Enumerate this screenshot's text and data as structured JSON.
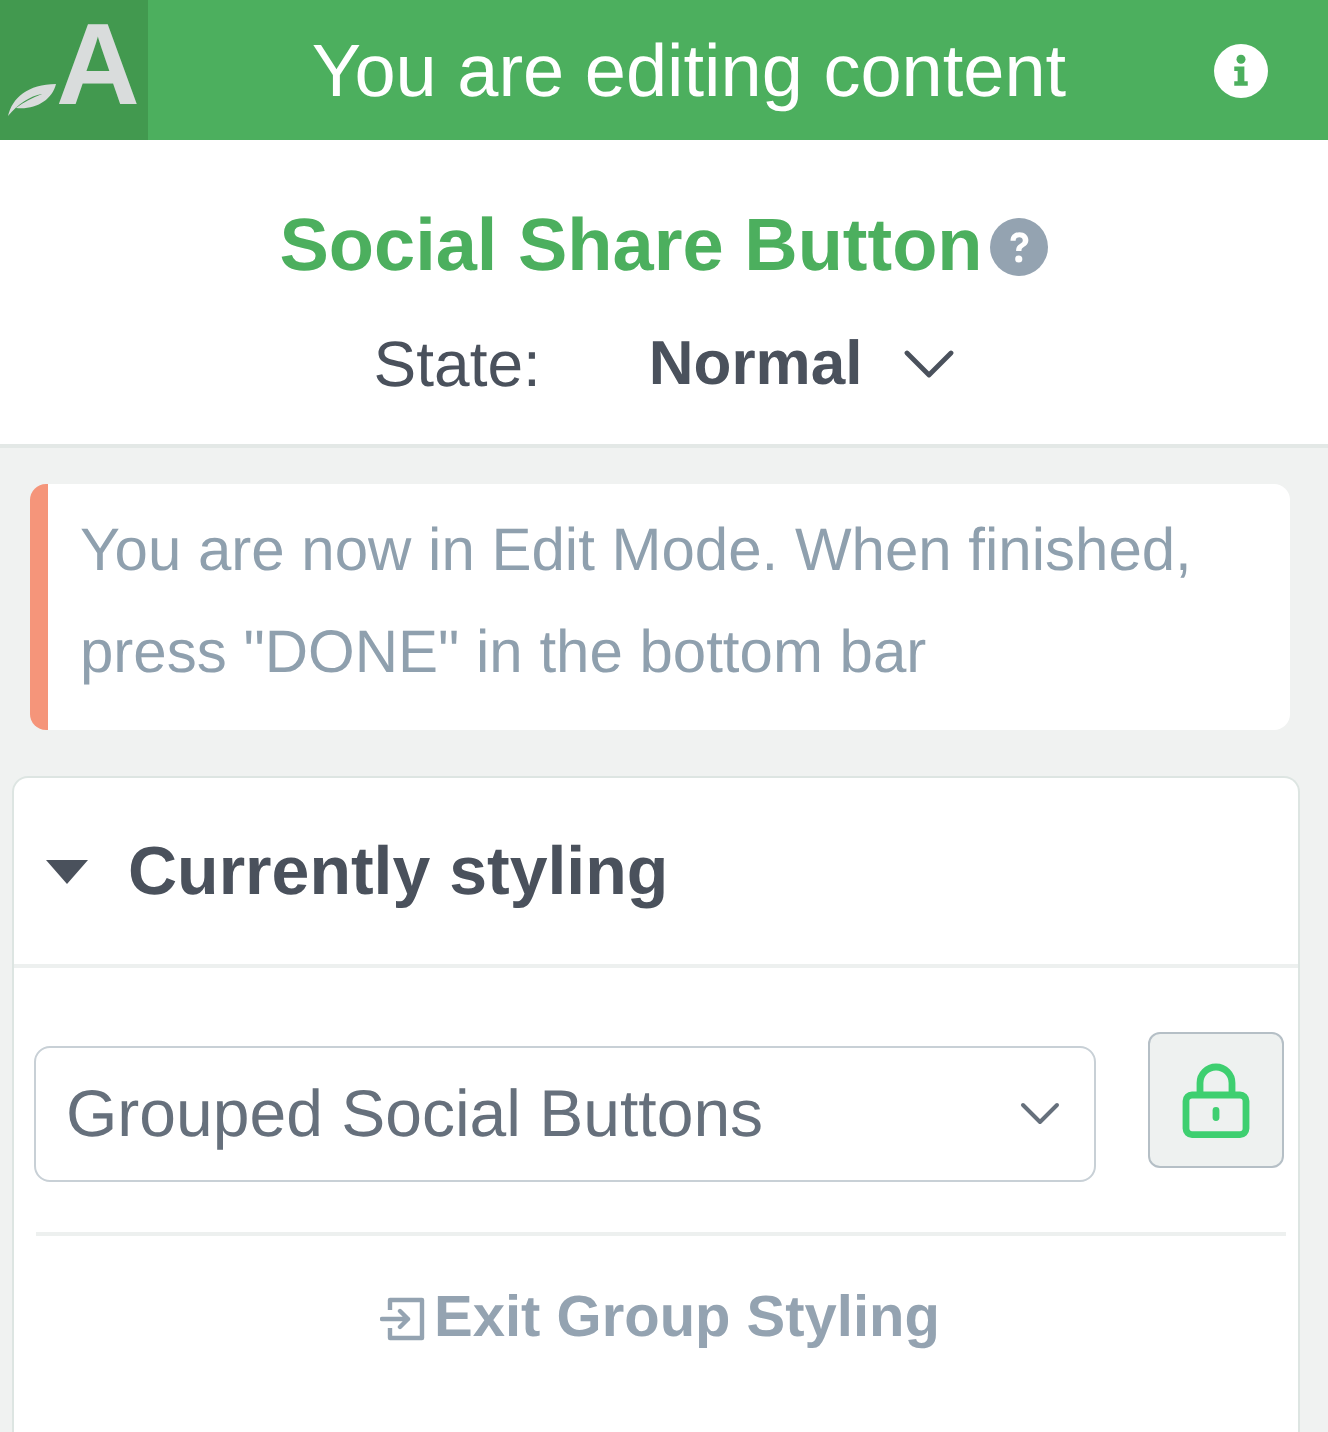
{
  "header": {
    "logo_letter": "A",
    "title": "You are editing content"
  },
  "element": {
    "title": "Social Share Button",
    "state_label": "State:",
    "state_value": "Normal"
  },
  "notice": {
    "text": "You are now in Edit Mode. When finished, press \"DONE\" in the bottom bar"
  },
  "panel": {
    "title": "Currently styling",
    "expanded": true,
    "select": {
      "value": "Grouped Social Buttons"
    },
    "exit_link": "Exit Group Styling"
  }
}
